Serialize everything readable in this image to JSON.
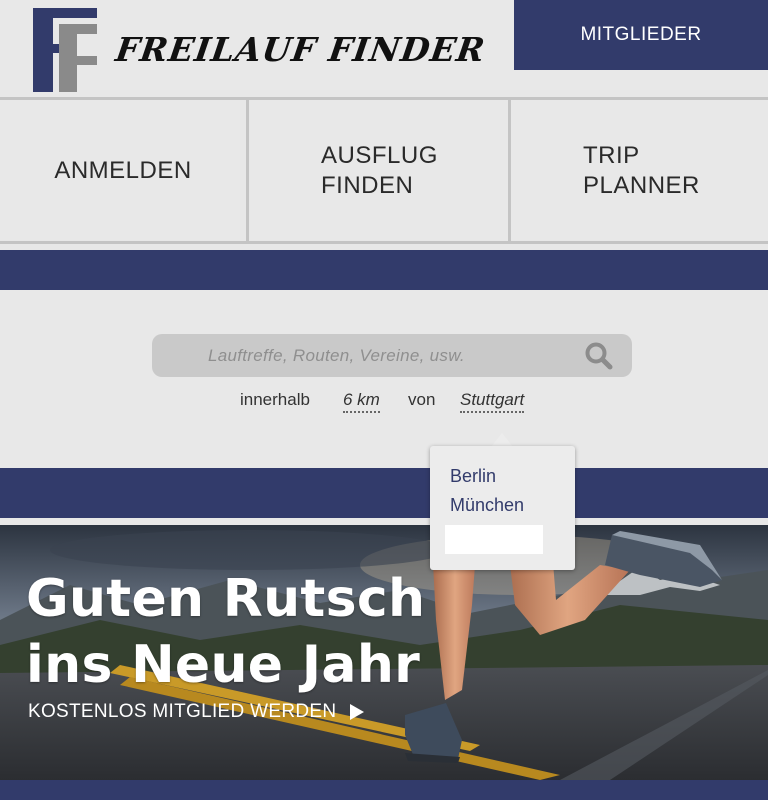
{
  "header": {
    "logo_letters": "FF",
    "logo_text": "FREILAUF FINDER",
    "members_label": "MITGLIEDER"
  },
  "nav": {
    "items": [
      {
        "label": "ANMELDEN"
      },
      {
        "label": "AUSFLUG\nFINDEN"
      },
      {
        "label": "TRIP\nPLANNER"
      }
    ]
  },
  "search": {
    "placeholder": "Lauftreffe, Routen, Vereine, usw.",
    "value": ""
  },
  "radius": {
    "prefix": "innerhalb",
    "distance": "6 km",
    "middle": "von",
    "city": "Stuttgart"
  },
  "city_dropdown": {
    "options": [
      "Berlin",
      "München"
    ],
    "custom_value": ""
  },
  "hero": {
    "title": "Guten Rutsch\nins Neue Jahr",
    "cta": "KOSTENLOS MITGLIED WERDEN"
  },
  "colors": {
    "brand_navy": "#323b6b",
    "background": "#e8e8e8"
  }
}
